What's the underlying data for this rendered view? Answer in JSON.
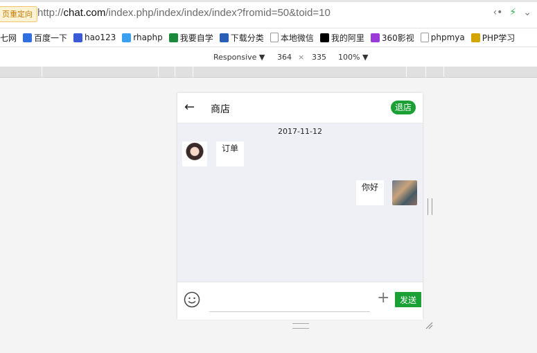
{
  "browser": {
    "redirect_badge": "页重定向",
    "url_prefix": "http://",
    "url_host": "chat.com",
    "url_path": "/index.php/index/index/index?fromid=50&toid=10",
    "share_icon": "share-icon",
    "bolt_icon": "lightning-icon",
    "chevron_icon": "chevron-down-icon"
  },
  "bookmarks": [
    {
      "label": "七网",
      "icon": "globe-icon",
      "color": "#e74c3c"
    },
    {
      "label": "百度一下",
      "icon": "baidu-paw-icon",
      "color": "#2f6fe0"
    },
    {
      "label": "hao123",
      "icon": "hao123-icon",
      "color": "#3b5bd6"
    },
    {
      "label": "rhaphp",
      "icon": "rhaphp-icon",
      "color": "#3ba0f0"
    },
    {
      "label": "我要自学",
      "icon": "zixue-icon",
      "color": "#1a8a3a"
    },
    {
      "label": "下载分类",
      "icon": "folder-icon",
      "color": "#2a5fb8"
    },
    {
      "label": "本地微信",
      "icon": "page-icon",
      "color": "#ffffff"
    },
    {
      "label": "我的阿里",
      "icon": "penguin-icon",
      "color": "#000000"
    },
    {
      "label": "360影视",
      "icon": "360-icon",
      "color": "#9b3ad6"
    },
    {
      "label": "phpmya",
      "icon": "page-icon",
      "color": "#ffffff"
    },
    {
      "label": "PHP学习",
      "icon": "php-icon",
      "color": "#d4a400"
    }
  ],
  "devtools": {
    "mode": "Responsive ▼",
    "width": "364",
    "times": "×",
    "height": "335",
    "zoom": "100% ▼"
  },
  "chat": {
    "back_icon": "arrow-left-icon",
    "title": "商店",
    "leave_label": "退店",
    "date": "2017-11-12",
    "messages": [
      {
        "side": "left",
        "text": "订单"
      },
      {
        "side": "right",
        "text": "你好"
      }
    ],
    "input_placeholder": "",
    "send_label": "发送",
    "emoji_icon": "smiley-icon",
    "plus_icon": "plus-icon"
  },
  "colors": {
    "accent": "#1aa035",
    "chat_bg": "#eef0f5"
  }
}
